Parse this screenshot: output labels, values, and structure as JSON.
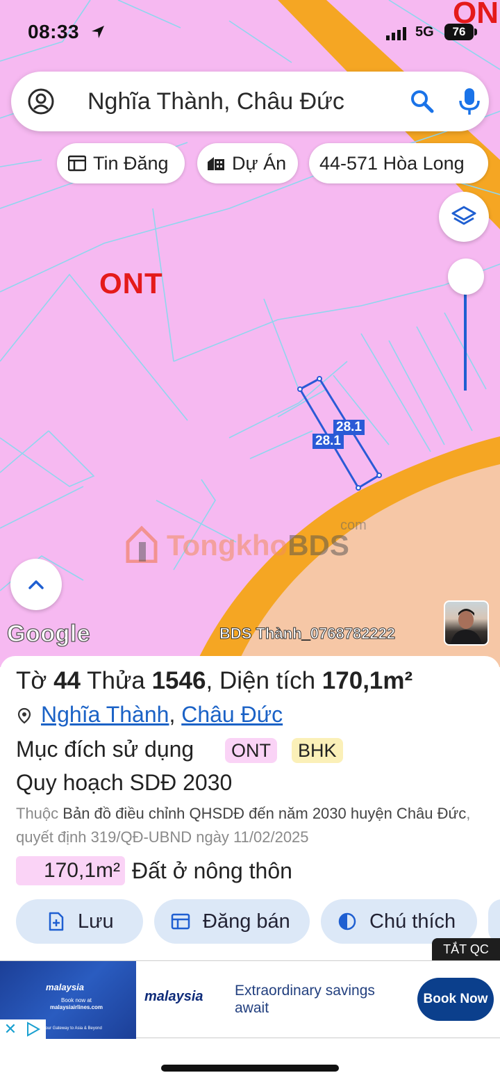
{
  "status_bar": {
    "time": "08:33",
    "network": "5G",
    "battery": "76"
  },
  "search": {
    "query": "Nghĩa Thành, Châu Đức"
  },
  "chips": [
    {
      "label": "Tin Đăng",
      "icon": "listing-icon"
    },
    {
      "label": "Dự Án",
      "icon": "building-icon"
    },
    {
      "label": "44-571 Hòa Long",
      "icon": ""
    }
  ],
  "map": {
    "zone_label": "ONT",
    "zone_label_top": "ON",
    "edge_dim_1": "28.1",
    "edge_dim_2": "28.1",
    "watermark_main": "Tongkho",
    "watermark_bold": "BDS",
    "watermark_suffix": "com",
    "google_logo": "Google",
    "credit": "BDS Thành_0768782222",
    "colors": {
      "land_ont": "#f6b9f1",
      "road": "#f5a623",
      "other_zone": "#f6c7a6",
      "parcel_outline": "#2a5ad6"
    }
  },
  "parcel": {
    "sheet_label": "Tờ",
    "sheet_no": "44",
    "parcel_label": "Thửa",
    "parcel_no": "1546",
    "area_label": "Diện tích",
    "area": "170,1m²",
    "ward": "Nghĩa Thành",
    "district": "Châu Đức",
    "purpose_label": "Mục đích sử dụng",
    "purpose_tags": [
      "ONT",
      "BHK"
    ],
    "plan_title": "Quy hoạch SDĐ 2030",
    "plan_prefix": "Thuộc",
    "plan_name": "Bản đồ điều chỉnh QHSDĐ đến năm 2030 huyện Châu Đức",
    "plan_decision": ", quyết định 319/QĐ-UBND ngày 11/02/2025",
    "plan_area": "170,1m²",
    "plan_type": "Đất ở nông thôn"
  },
  "actions": [
    {
      "label": "Lưu"
    },
    {
      "label": "Đăng bán"
    },
    {
      "label": "Chú thích"
    }
  ],
  "ad": {
    "toggle_label": "TẮT QC",
    "brand": "malaysia",
    "thumb_line1": "Book now at",
    "thumb_line2": "malaysiairlines.com",
    "thumb_line3": "Your Gateway to Asia & Beyond",
    "copy": "Extraordinary savings await",
    "cta": "Book Now"
  }
}
